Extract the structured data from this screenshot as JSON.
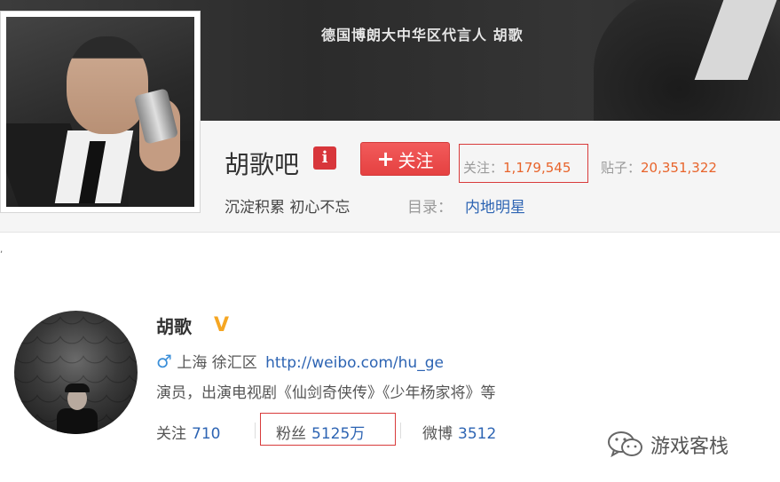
{
  "tieba": {
    "banner_text": "德国博朗大中华区代言人 胡歌",
    "name": "胡歌吧",
    "badge": "i",
    "follow_button_label": "关注",
    "stats": {
      "follow_label": "关注：",
      "follow_count": "1,179,545",
      "posts_label": "贴子：",
      "posts_count": "20,351,322"
    },
    "slogan": "沉淀积累 初心不忘",
    "category_label": "目录：",
    "category": "内地明星"
  },
  "stray_mark": ",",
  "weibo": {
    "name": "胡歌",
    "verified_mark": "V",
    "location": "上海 徐汇区",
    "url": "http://weibo.com/hu_ge",
    "bio": "演员，出演电视剧《仙剑奇侠传》《少年杨家将》等",
    "stats": {
      "following_label": "关注",
      "following_count": "710",
      "fans_label": "粉丝",
      "fans_count": "5125万",
      "posts_label": "微博",
      "posts_count": "3512"
    }
  },
  "watermark": {
    "text": "游戏客栈",
    "icon": "wechat-icon"
  },
  "colors": {
    "accent_red": "#e54141",
    "link_blue": "#2d64b3",
    "count_orange": "#e8642b",
    "verified_gold": "#f5a623",
    "highlight_box": "#d83b3b"
  }
}
